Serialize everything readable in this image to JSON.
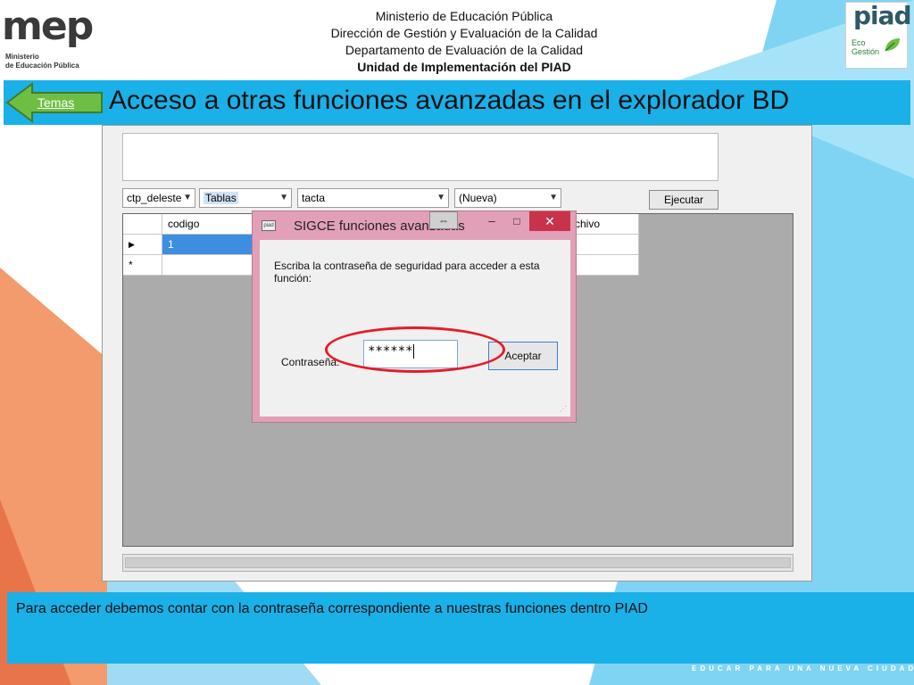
{
  "header": {
    "logo_left": {
      "word": "mep",
      "sub1": "Ministerio",
      "sub2": "de Educación Pública"
    },
    "lines": [
      "Ministerio de Educación Pública",
      "Dirección de Gestión y Evaluación de la Calidad",
      "Departamento de Evaluación de la Calidad",
      "Unidad de Implementación del PIAD"
    ],
    "logo_right": {
      "word": "piad",
      "eco1": "Eco",
      "eco2": "Gestión"
    }
  },
  "title_bar": {
    "back_label": "Temas",
    "title": "Acceso a otras funciones avanzadas en el explorador BD"
  },
  "app": {
    "combos": [
      {
        "value": "ctp_deleste"
      },
      {
        "value": "Tablas"
      },
      {
        "value": "tacta"
      },
      {
        "value": "(Nueva)"
      }
    ],
    "execute_label": "Ejecutar",
    "grid": {
      "col_codigo": "codigo",
      "col_archivo": "chivo",
      "row1_marker": "▶",
      "row1_value": "1",
      "row2_marker": "*"
    }
  },
  "dialog": {
    "title": "SIGCE funciones avanzadas",
    "icon_text": "piad",
    "minimize": "–",
    "maximize": "□",
    "close": "✕",
    "resize_tab": "⇔",
    "message": "Escriba la contraseña de seguridad para acceder a esta función:",
    "password_label": "Contraseña:",
    "password_value": "******",
    "accept_label": "Aceptar"
  },
  "caption": {
    "text": "Para acceder debemos contar con la contraseña correspondiente a nuestras funciones dentro PIAD"
  },
  "footer": {
    "text": "EDUCAR PARA UNA NUEVA CIUDADANÍA"
  },
  "colors": {
    "accent_blue": "#1ab0e8",
    "light_blue": "#7fd4f4",
    "orange": "#f39b6d",
    "dialog_pink": "#e2a0b8",
    "highlight_red": "#e51b2a",
    "arrow_green": "#6fbe44"
  }
}
